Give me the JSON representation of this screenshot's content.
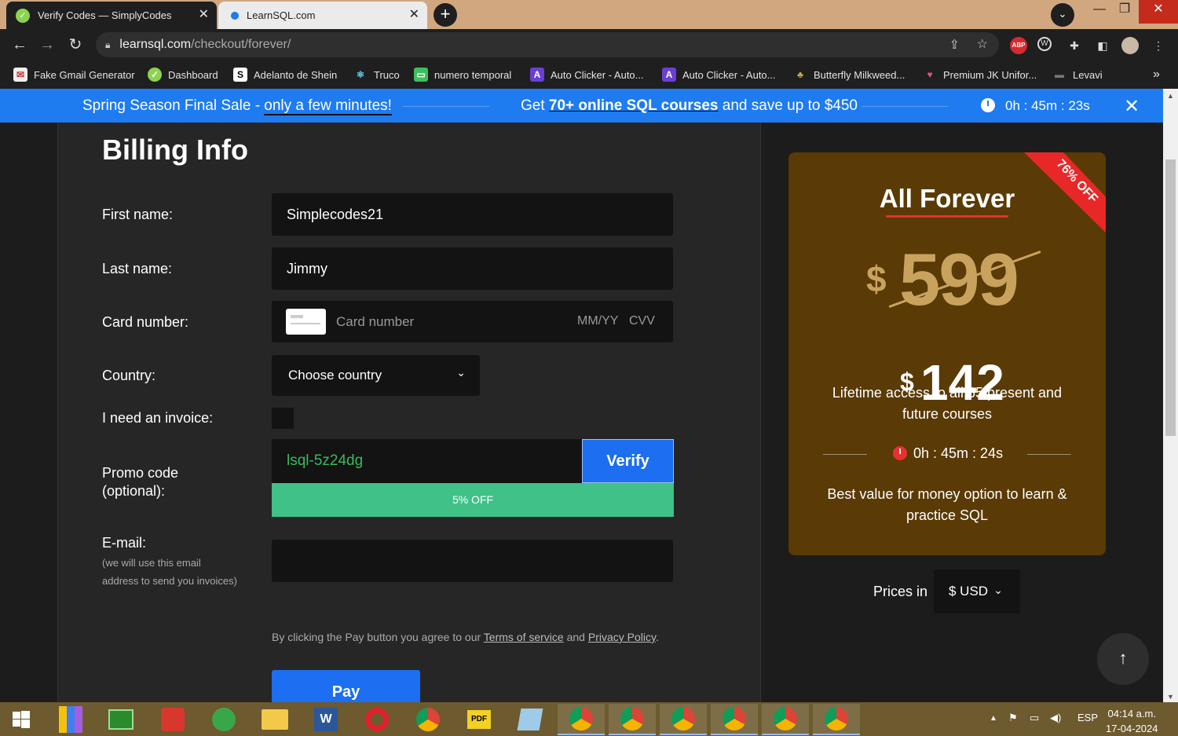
{
  "browser": {
    "tabs": [
      {
        "title": "Verify Codes — SimplyCodes",
        "active": true
      },
      {
        "title": "LearnSQL.com",
        "active": false
      }
    ],
    "new_tab_icon": "+",
    "url": {
      "host": "learnsql.com",
      "path": "/checkout/forever/"
    },
    "bookmarks": [
      "Fake Gmail Generator",
      "Dashboard",
      "Adelanto de Shein",
      "Truco",
      "numero temporal",
      "Auto Clicker - Auto...",
      "Auto Clicker - Auto...",
      "Butterfly Milkweed...",
      "Premium JK Unifor...",
      "Levavi"
    ],
    "bookmark_overflow": "»",
    "extension_abp": "ABP"
  },
  "banner": {
    "sale_prefix": "Spring Season Final Sale - ",
    "sale_emphasis": "only a few minutes!",
    "offer_prefix": "Get ",
    "offer_bold": "70+ online SQL courses",
    "offer_suffix": " and save up to $450",
    "timer": "0h : 45m : 23s",
    "close": "✕"
  },
  "form": {
    "title": "Billing Info",
    "first_name_label": "First name:",
    "first_name_value": "Simplecodes21",
    "last_name_label": "Last name:",
    "last_name_value": "Jimmy",
    "card_label": "Card number:",
    "card_placeholder": "Card number",
    "expiry_placeholder": "MM/YY",
    "cvv_placeholder": "CVV",
    "country_label": "Country:",
    "country_value": "Choose country",
    "invoice_label": "I need an invoice:",
    "invoice_checked": false,
    "promo_label_1": "Promo code",
    "promo_label_2": "(optional):",
    "promo_value": "lsql-5z24dg",
    "verify_label": "Verify",
    "discount_label": "5% OFF",
    "email_label": "E-mail:",
    "email_hint_1": "(we will use this email",
    "email_hint_2": "address to send you invoices)",
    "email_value": "",
    "terms_prefix": "By clicking the Pay button you agree to our ",
    "terms_link": "Terms of service",
    "terms_and": " and ",
    "privacy_link": "Privacy Policy",
    "terms_suffix": ".",
    "pay_label": "Pay"
  },
  "product": {
    "ribbon": "76% OFF",
    "name": "All Forever",
    "currency_symbol": "$",
    "old_price": "599",
    "new_price": "142",
    "description": "Lifetime access to all 65 present and future courses",
    "timer": "0h : 45m : 24s",
    "best_value": "Best value for money option to learn & practice SQL",
    "prices_in_label": "Prices in",
    "currency_value": "$ USD"
  },
  "colors": {
    "banner_blue": "#1e7bf0",
    "card_brown": "#5a3a05",
    "ribbon_red": "#e82828",
    "discount_green": "#3fc187",
    "promo_text_green": "#3cb95c",
    "button_blue": "#1d6ef0"
  },
  "taskbar": {
    "language": "ESP",
    "time": "04:14 a.m.",
    "date": "17-04-2024"
  }
}
